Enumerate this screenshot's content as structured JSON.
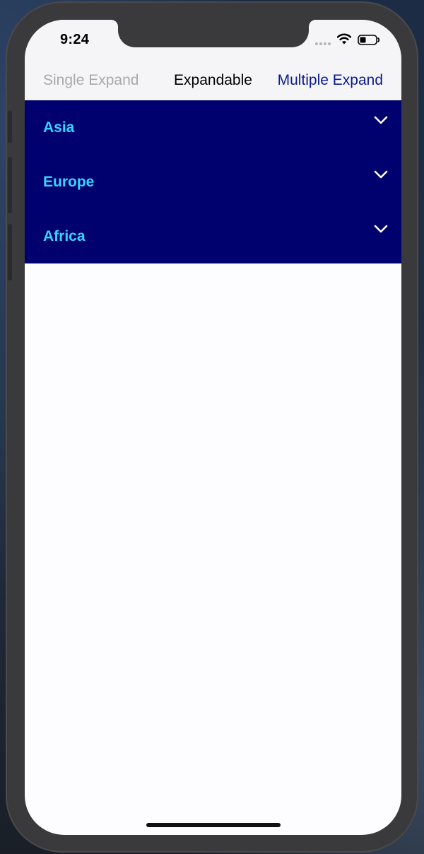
{
  "status_bar": {
    "time": "9:24",
    "icons": [
      "cellular-signal-icon",
      "wifi-icon",
      "battery-icon"
    ]
  },
  "nav": {
    "left_label": "Single Expand",
    "title": "Expandable",
    "right_label": "Multiple Expand"
  },
  "sections": [
    {
      "label": "Asia",
      "icon": "chevron-down-icon"
    },
    {
      "label": "Europe",
      "icon": "chevron-down-icon"
    },
    {
      "label": "Africa",
      "icon": "chevron-down-icon"
    }
  ],
  "colors": {
    "accordion_background": "#01006f",
    "section_label": "#33d6ff",
    "nav_active": "#0c1c8f",
    "nav_inactive": "#a9a9ad"
  }
}
